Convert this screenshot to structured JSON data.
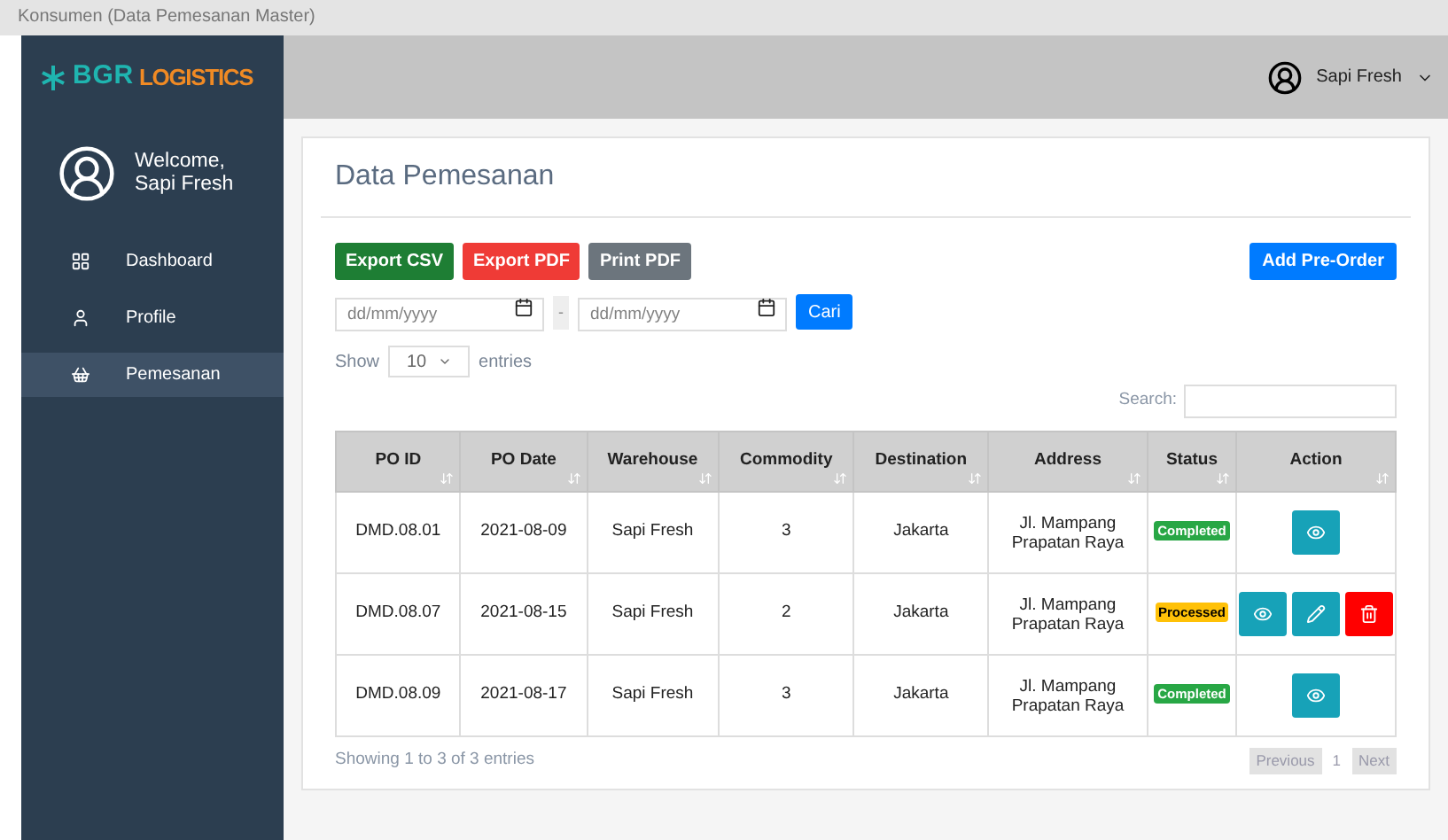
{
  "window": {
    "title": "Konsumen (Data Pemesanan Master)"
  },
  "logo": {
    "part_1": "BGR",
    "part_2": "LOGISTICS"
  },
  "user_menu": {
    "name": "Sapi Fresh"
  },
  "sidebar": {
    "welcome": "Welcome,",
    "user": "Sapi Fresh",
    "items": [
      {
        "label": "Dashboard",
        "selected": false
      },
      {
        "label": "Profile",
        "selected": false
      },
      {
        "label": "Pemesanan",
        "selected": true
      }
    ]
  },
  "page": {
    "title": "Data Pemesanan",
    "buttons": [
      {
        "label": "Export CSV",
        "kind": "csv"
      },
      {
        "label": "Export PDF",
        "kind": "pdf"
      },
      {
        "label": "Print PDF",
        "kind": "print"
      }
    ],
    "add_button": "Add Pre-Order",
    "date_from": {
      "placeholder": "dd/mm/yyyy"
    },
    "separator": "-",
    "date_to": {
      "placeholder": "dd/mm/yyyy"
    },
    "search_button": "Cari",
    "show_label": "Show",
    "page_size": "10",
    "entries_label": "entries",
    "search_label": "Search:"
  },
  "table": {
    "columns": [
      "PO ID",
      "PO Date",
      "Warehouse",
      "Commodity",
      "Destination",
      "Address",
      "Status",
      "Action"
    ],
    "rows": [
      {
        "cells": [
          "DMD.08.01",
          "2021-08-09",
          "Sapi Fresh",
          "3",
          "Jakarta",
          "Jl. Mampang Prapatan Raya"
        ],
        "status": {
          "label": "Completed",
          "kind": "completed"
        },
        "actions": [
          {
            "kind": "view"
          }
        ]
      },
      {
        "cells": [
          "DMD.08.07",
          "2021-08-15",
          "Sapi Fresh",
          "2",
          "Jakarta",
          "Jl. Mampang Prapatan Raya"
        ],
        "status": {
          "label": "Processed",
          "kind": "processed"
        },
        "actions": [
          {
            "kind": "view"
          },
          {
            "kind": "edit"
          },
          {
            "kind": "delete"
          }
        ]
      },
      {
        "cells": [
          "DMD.08.09",
          "2021-08-17",
          "Sapi Fresh",
          "3",
          "Jakarta",
          "Jl. Mampang Prapatan Raya"
        ],
        "status": {
          "label": "Completed",
          "kind": "completed"
        },
        "actions": [
          {
            "kind": "view"
          }
        ]
      }
    ]
  },
  "footer": {
    "info": "Showing 1 to 3 of 3 entries",
    "previous": "Previous",
    "page": "1",
    "next": "Next"
  }
}
